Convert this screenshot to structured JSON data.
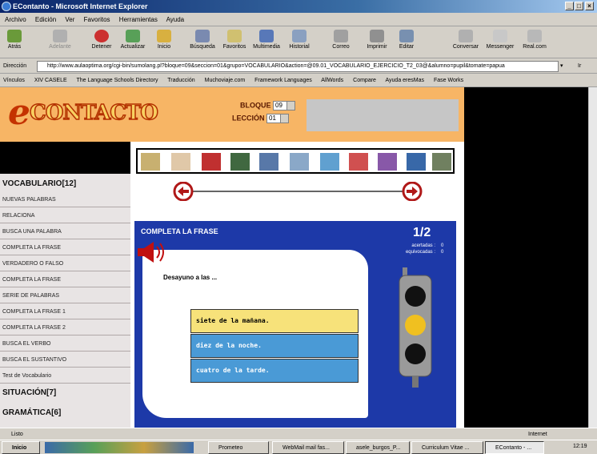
{
  "window": {
    "title": "EContanto - Microsoft Internet Explorer"
  },
  "menu": [
    "Archivo",
    "Edición",
    "Ver",
    "Favoritos",
    "Herramientas",
    "Ayuda"
  ],
  "toolbar": [
    "Atrás",
    "Adelante",
    "Detener",
    "Actualizar",
    "Inicio",
    "Búsqueda",
    "Favoritos",
    "Multimedia",
    "Historial",
    "Correo",
    "Imprimir",
    "Editar",
    "Conversar",
    "Messenger",
    "Real.com"
  ],
  "address": {
    "label": "Dirección",
    "url": "http://www.aulaoptima.org/cgi-bin/sumolang.pl?bloque=09&seccion=01&grupo=VOCABULARIO&action=@09.01_VOCABULARIO_EJERCICIO_T2_03@&alumno=pupil&tomate=papua",
    "go": "Ir"
  },
  "links": {
    "label": "Vínculos",
    "items": [
      "XIV CASELE",
      "The Language Schools Directory",
      "Traducción",
      "Muchoviaje.com",
      "Framework Languages",
      "AllWords",
      "Compare",
      "Ayuda eresMas",
      "Fase Works"
    ]
  },
  "site": {
    "logo": "CONTACTO",
    "logo_e": "e",
    "bloque_label": "BLOQUE",
    "bloque_value": "09",
    "leccion_label": "LECCIÓN",
    "leccion_value": "01"
  },
  "sidebar": {
    "vocab": "VOCABULARIO[12]",
    "items": [
      "NUEVAS PALABRAS",
      "RELACIONA",
      "BUSCA UNA PALABRA",
      "COMPLETA LA FRASE",
      "VERDADERO O FALSO",
      "COMPLETA LA FRASE",
      "SERIE DE PALABRAS",
      "COMPLETA LA FRASE 1",
      "COMPLETA LA FRASE 2",
      "BUSCA EL VERBO",
      "BUSCA EL SUSTANTIVO",
      "Test de Vocabulario"
    ],
    "situacion": "SITUACIÓN[7]",
    "gramatica": "GRAMÁTICA[6]"
  },
  "exercise": {
    "title": "COMPLETA LA FRASE",
    "progress": "1/2",
    "acertadas_label": "acertadas :",
    "acertadas": "0",
    "equivocadas_label": "equivocadas :",
    "equivocadas": "0",
    "question": "Desayuno a las ...",
    "answers": [
      "siete de la mañana.",
      "diez de la noche.",
      "cuatro de la tarde."
    ]
  },
  "colors": {
    "selected": "#f7e27a",
    "option": "#4a9ad6",
    "panel": "#1d39a8"
  },
  "status": {
    "left": "Listo",
    "zone": "Internet"
  },
  "taskbar": {
    "start": "Inicio",
    "tasks": [
      "Prometeo",
      "WebMail mail fas...",
      "asele_burgos_P...",
      "Curriculum Vitae ...",
      "EContanto - ..."
    ],
    "clock": "12:19"
  }
}
